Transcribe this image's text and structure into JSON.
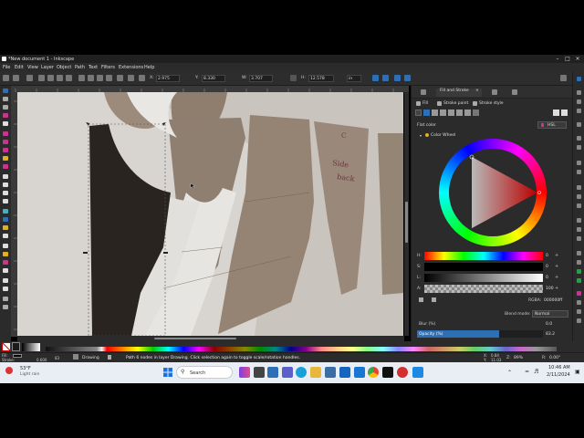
{
  "window": {
    "title": "*New document 1 - Inkscape"
  },
  "menu": [
    "File",
    "Edit",
    "View",
    "Layer",
    "Object",
    "Path",
    "Text",
    "Filters",
    "Extensions",
    "Help"
  ],
  "toolbar": {
    "x_label": "X:",
    "x_value": "2.975",
    "y_label": "Y:",
    "y_value": "8.330",
    "w_label": "W:",
    "w_value": "3.707",
    "h_label": "H:",
    "h_value": "12.578",
    "unit": "in"
  },
  "canvas": {
    "note_side_back": "Side\nback",
    "note_c": "C"
  },
  "panel": {
    "tabs": [
      "Fill and Stroke",
      "×"
    ],
    "subtabs": [
      "Fill",
      "Stroke paint",
      "Stroke style"
    ],
    "fill_type": "Flat color",
    "color_mode": "HSL",
    "color_wheel_label": "Color Wheel",
    "hsl": [
      {
        "label": "H:",
        "value": "0"
      },
      {
        "label": "S:",
        "value": "0"
      },
      {
        "label": "L:",
        "value": "0"
      },
      {
        "label": "A:",
        "value": "100"
      }
    ],
    "rgba_label": "RGBA:",
    "rgba_value": "000000ff",
    "blend_label": "Blend mode:",
    "blend_value": "Normal",
    "blur_label": "Blur (%)",
    "blur_value": "0.0",
    "opacity_label": "Opacity (%)",
    "opacity_value": "83.2"
  },
  "status": {
    "fill_label": "Fill:",
    "stroke_label": "Stroke:",
    "stroke_value": "0.600",
    "opacity_value": "83",
    "layer": "Drawing",
    "message": "Path 6 nodes in layer Drawing. Click selection again to toggle scale/rotation handles.",
    "x_label": "X:",
    "x_value": "0.84",
    "y_label": "Y:",
    "y_value": "11.03",
    "zoom_label": "Z:",
    "zoom_value": "89%",
    "rot_label": "R:",
    "rot_value": "0.00°"
  },
  "taskbar": {
    "weather_temp": "53°F",
    "weather_desc": "Light rain",
    "search_placeholder": "Search",
    "time": "10:46 AM",
    "date": "2/11/2024"
  },
  "colors": {
    "accent": "#2c6fb5",
    "selected_fill": "#000000"
  }
}
